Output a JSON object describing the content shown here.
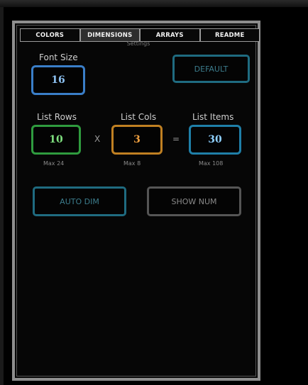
{
  "tabs": [
    {
      "label": "COLORS"
    },
    {
      "label": "DIMENSIONS"
    },
    {
      "label": "ARRAYS"
    },
    {
      "label": "README"
    }
  ],
  "settings_label": "Settings",
  "font_size": {
    "label": "Font Size",
    "value": "16",
    "color": "#3a7ec8"
  },
  "default_button": {
    "label": "DEFAULT",
    "color": "#1f6b80"
  },
  "list_rows": {
    "label": "List Rows",
    "value": "10",
    "max": "Max 24",
    "color": "#2f9b3e"
  },
  "list_cols": {
    "label": "List Cols",
    "value": "3",
    "max": "Max 8",
    "color": "#c08022"
  },
  "list_items": {
    "label": "List Items",
    "value": "30",
    "max": "Max 108",
    "color": "#1f7fa8"
  },
  "operators": {
    "times": "X",
    "equals": "="
  },
  "auto_dim_button": {
    "label": "AUTO DIM",
    "color": "#1f6b80"
  },
  "show_num_button": {
    "label": "SHOW NUM",
    "color": "#555555"
  }
}
